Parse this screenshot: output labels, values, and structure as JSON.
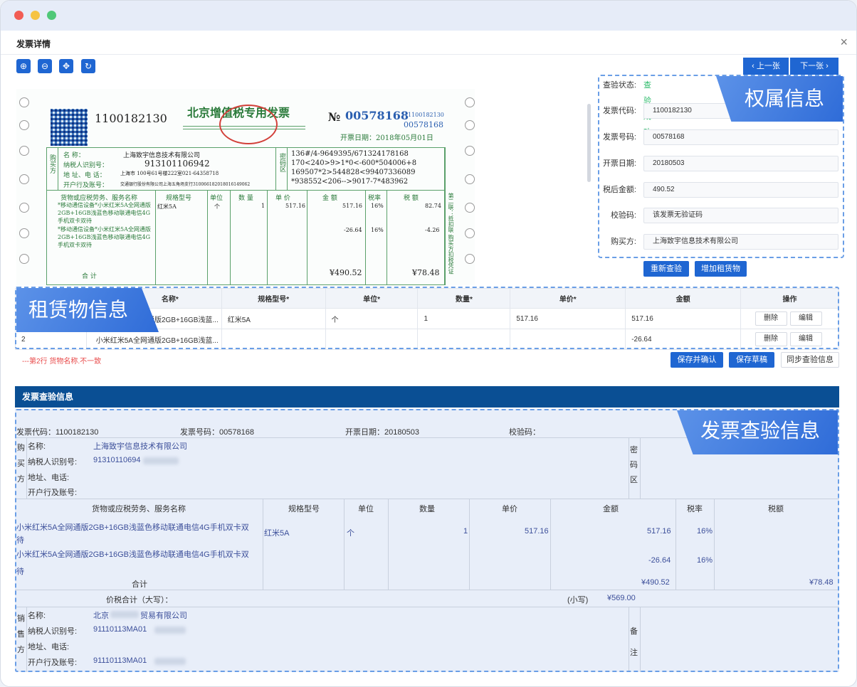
{
  "window": {
    "title": "发票详情",
    "close": "×"
  },
  "tools": {
    "zoom_in": "⊕",
    "zoom_out": "⊖",
    "move": "✥",
    "rotate": "↻"
  },
  "nav": {
    "prev": "‹ 上一张",
    "next": "下一张 ›"
  },
  "invoice": {
    "code": "1100182130",
    "title": "北京增值税专用发票",
    "no_prefix": "№",
    "no": "00578168",
    "small_code": "1100182130",
    "small_no": "00578168",
    "date": "开票日期：2018年05月01日",
    "buyer_name_label": "名 称：",
    "buyer_name": "上海致宇信息技术有限公司",
    "buyer_tax_label": "纳税人识别号：",
    "buyer_tax": "913101106942",
    "buyer_addr_label": "地 址、电 话：",
    "buyer_addr": "上海市            100号61号楼222室021-64358718",
    "buyer_bank_label": "开户行及账号：",
    "buyer_bank": "交通银行股份有限公司上海五角场支行310066182018016149062",
    "cipher_label": "密码区",
    "cipher": [
      "136#/4-9649395/671324178168",
      "170<240>9>1*0<-600*504006+8",
      "169507*2>544828<99407336089",
      "*938552<206-->9017-7*483962"
    ],
    "col_goods": "货物或应税劳务、服务名称",
    "col_spec": "规格型号",
    "col_unit": "单位",
    "col_qty": "数 量",
    "col_price": "单 价",
    "col_amount": "金 额",
    "col_rate": "税率",
    "col_tax": "税 额",
    "row1_goods": "*移动通信设备*小米红米5A全网通版2GB+16GB浅蓝色移动联通电信4G手机双卡双待",
    "row1_spec": "红米5A",
    "row1_unit": "个",
    "row1_qty": "1",
    "row1_price": "517.16",
    "row1_amount": "517.16",
    "row1_rate": "16%",
    "row1_tax": "82.74",
    "row2_goods": "*移动通信设备*小米红米5A全网通版2GB+16GB浅蓝色移动联通电信4G手机双卡双待",
    "row2_amount": "-26.64",
    "row2_rate": "16%",
    "row2_tax": "-4.26",
    "total_label": "合 计",
    "total_amount": "¥490.52",
    "total_tax": "¥78.48",
    "buyer_side": "购买方",
    "right_side": "第二联：抵扣联 购买方扣税凭证"
  },
  "panel": {
    "status_label": "查验状态:",
    "status_value": "查验成功",
    "ribbon": "权属信息",
    "fields": [
      {
        "label": "发票代码:",
        "value": "1100182130"
      },
      {
        "label": "发票号码:",
        "value": "00578168"
      },
      {
        "label": "开票日期:",
        "value": "20180503"
      },
      {
        "label": "税后金额:",
        "value": "490.52"
      },
      {
        "label": "校验码:",
        "value": "该发票无验证码"
      },
      {
        "label": "购买方:",
        "value": "上海致宇信息技术有限公司"
      }
    ],
    "recheck": "重新查验",
    "add_goods": "增加租赁物"
  },
  "goods": {
    "ribbon": "租赁物信息",
    "headers": [
      "",
      "名称*",
      "规格型号*",
      "单位*",
      "数量*",
      "单价*",
      "金额",
      "操作"
    ],
    "rows": [
      {
        "idx": "1",
        "name": "小米红米5A全网通版2GB+16GB浅蓝...",
        "spec": "红米5A",
        "unit": "个",
        "qty": "1",
        "price": "517.16",
        "amount": "517.16"
      },
      {
        "idx": "2",
        "name": "小米红米5A全网通版2GB+16GB浅蓝...",
        "spec": "",
        "unit": "",
        "qty": "",
        "price": "",
        "amount": "-26.64"
      }
    ],
    "delete": "删除",
    "edit": "编辑",
    "error": "---第2行 货物名称.不一致",
    "save_confirm": "保存并确认",
    "save_draft": "保存草稿",
    "sync": "同步查验信息"
  },
  "verify": {
    "header": "发票查验信息",
    "ribbon": "发票查验信息",
    "code": "发票代码：1100182130",
    "no": "发票号码：00578168",
    "date": "开票日期：20180503",
    "check": "校验码：",
    "buyer_side": [
      "购",
      "买",
      "方"
    ],
    "buyer_name_label": "名称:",
    "buyer_name": "上海致宇信息技术有限公司",
    "buyer_tax_label": "纳税人识别号:",
    "buyer_tax": "91310110694",
    "buyer_addr_label": "地址、电话:",
    "buyer_bank_label": "开户行及账号:",
    "cipher": [
      "密",
      "码",
      "区"
    ],
    "col_goods": "货物或应税劳务、服务名称",
    "col_spec": "规格型号",
    "col_unit": "单位",
    "col_qty": "数量",
    "col_price": "单价",
    "col_amount": "金额",
    "col_rate": "税率",
    "col_tax": "税额",
    "row1_goods_a": "小米红米5A全网通版2GB+16GB浅蓝色移动联通电信4G手机双卡双",
    "row1_goods_b": "待",
    "row1_spec": "红米5A",
    "row1_unit": "个",
    "row1_qty": "1",
    "row1_price": "517.16",
    "row1_amount": "517.16",
    "row1_rate": "16%",
    "row2_goods_a": "小米红米5A全网通版2GB+16GB浅蓝色移动联通电信4G手机双卡双",
    "row2_goods_b": "待",
    "row2_amount": "-26.64",
    "row2_rate": "16%",
    "total_label": "合计",
    "total_amount": "¥490.52",
    "total_tax": "¥78.48",
    "sum_label": "价税合计（大写）：",
    "sum_small_label": "(小写)",
    "sum_small": "¥569.00",
    "seller_side": [
      "销",
      "售",
      "方"
    ],
    "seller_name_label": "名称:",
    "seller_name_a": "北京",
    "seller_name_b": "贸易有限公司",
    "seller_tax_label": "纳税人识别号:",
    "seller_tax": "91110113MA01",
    "seller_addr_label": "地址、电话:",
    "seller_bank_label": "开户行及账号:",
    "seller_bank": "91110113MA01",
    "remark": [
      "备",
      "注"
    ]
  }
}
